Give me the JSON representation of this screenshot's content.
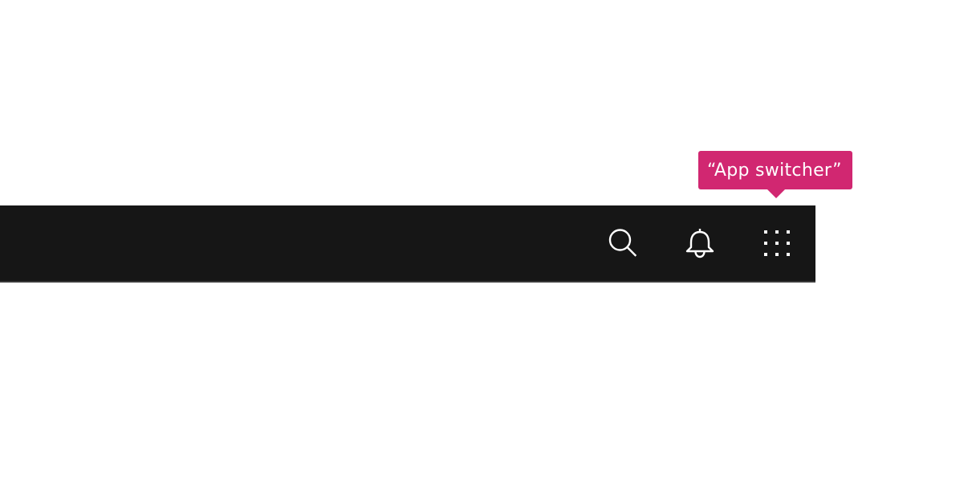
{
  "colors": {
    "header_background": "#161616",
    "header_border": "#393939",
    "icon_color": "#ffffff",
    "annotation_color": "#d12771"
  },
  "header": {
    "actions": [
      {
        "icon": "search-icon"
      },
      {
        "icon": "notification-bell-icon"
      },
      {
        "icon": "app-switcher-grid-icon"
      }
    ]
  },
  "annotation": {
    "label": "“App switcher”",
    "target": "app-switcher-button"
  }
}
